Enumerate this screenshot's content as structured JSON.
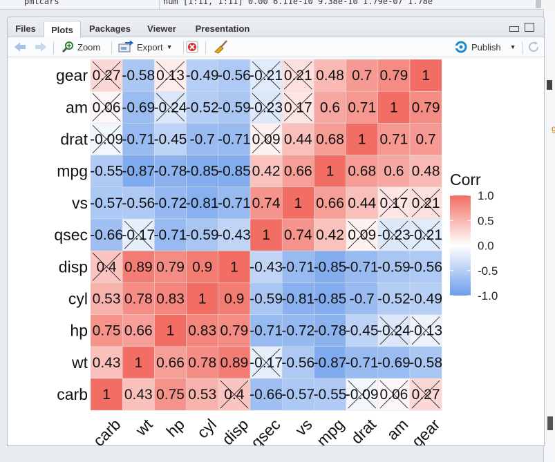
{
  "console_strip": {
    "name": "pmtcars",
    "value": "num [1:11, 1:11] 0.00 6.11e-10 9.38e-10 1.79e-07 1.78e"
  },
  "tabs": [
    {
      "label": "Files",
      "active": false
    },
    {
      "label": "Plots",
      "active": true
    },
    {
      "label": "Packages",
      "active": false
    },
    {
      "label": "Viewer",
      "active": false
    },
    {
      "label": "Presentation",
      "active": false
    }
  ],
  "toolbar": {
    "zoom": "Zoom",
    "export": "Export",
    "publish": "Publish"
  },
  "chart_data": {
    "type": "heatmap",
    "title": "",
    "x_categories": [
      "carb",
      "wt",
      "hp",
      "cyl",
      "disp",
      "qsec",
      "vs",
      "mpg",
      "drat",
      "am",
      "gear"
    ],
    "y_categories_top_to_bottom": [
      "gear",
      "am",
      "drat",
      "mpg",
      "vs",
      "qsec",
      "disp",
      "cyl",
      "hp",
      "wt",
      "carb"
    ],
    "values": [
      [
        "0.27",
        "-0.58",
        "0.13",
        "-0.49",
        "-0.56",
        "-0.21",
        "0.21",
        "0.48",
        "0.7",
        "0.79",
        "1"
      ],
      [
        "0.06",
        "-0.69",
        "-0.24",
        "-0.52",
        "-0.59",
        "-0.23",
        "0.17",
        "0.6",
        "0.71",
        "1",
        "0.79"
      ],
      [
        "-0.09",
        "-0.71",
        "-0.45",
        "-0.7",
        "-0.71",
        "0.09",
        "0.44",
        "0.68",
        "1",
        "0.71",
        "0.7"
      ],
      [
        "-0.55",
        "-0.87",
        "-0.78",
        "-0.85",
        "-0.85",
        "0.42",
        "0.66",
        "1",
        "0.68",
        "0.6",
        "0.48"
      ],
      [
        "-0.57",
        "-0.56",
        "-0.72",
        "-0.81",
        "-0.71",
        "0.74",
        "1",
        "0.66",
        "0.44",
        "0.17",
        "0.21"
      ],
      [
        "-0.66",
        "-0.17",
        "-0.71",
        "-0.59",
        "-0.43",
        "1",
        "0.74",
        "0.42",
        "0.09",
        "-0.23",
        "-0.21"
      ],
      [
        "0.4",
        "0.89",
        "0.79",
        "0.9",
        "1",
        "-0.43",
        "-0.71",
        "-0.85",
        "-0.71",
        "-0.59",
        "-0.56"
      ],
      [
        "0.53",
        "0.78",
        "0.83",
        "1",
        "0.9",
        "-0.59",
        "-0.81",
        "-0.85",
        "-0.7",
        "-0.52",
        "-0.49"
      ],
      [
        "0.75",
        "0.66",
        "1",
        "0.83",
        "0.79",
        "-0.71",
        "-0.72",
        "-0.78",
        "-0.45",
        "-0.24",
        "-0.13"
      ],
      [
        "0.43",
        "1",
        "0.66",
        "0.78",
        "0.89",
        "-0.17",
        "-0.56",
        "-0.87",
        "-0.71",
        "-0.69",
        "-0.58"
      ],
      [
        "1",
        "0.43",
        "0.75",
        "0.53",
        "0.4",
        "-0.66",
        "-0.57",
        "-0.55",
        "-0.09",
        "0.06",
        "0.27"
      ]
    ],
    "crossed_out": [
      [
        true,
        false,
        true,
        false,
        false,
        true,
        true,
        false,
        false,
        false,
        false
      ],
      [
        true,
        false,
        true,
        false,
        false,
        true,
        true,
        false,
        false,
        false,
        false
      ],
      [
        true,
        false,
        false,
        false,
        false,
        true,
        false,
        false,
        false,
        false,
        false
      ],
      [
        false,
        false,
        false,
        false,
        false,
        false,
        false,
        false,
        false,
        false,
        false
      ],
      [
        false,
        false,
        false,
        false,
        false,
        false,
        false,
        false,
        false,
        true,
        true
      ],
      [
        false,
        true,
        false,
        false,
        false,
        false,
        false,
        false,
        true,
        true,
        true
      ],
      [
        true,
        false,
        false,
        false,
        false,
        false,
        false,
        false,
        false,
        false,
        false
      ],
      [
        false,
        false,
        false,
        false,
        false,
        false,
        false,
        false,
        false,
        false,
        false
      ],
      [
        false,
        false,
        false,
        false,
        false,
        false,
        false,
        false,
        false,
        true,
        true
      ],
      [
        false,
        false,
        false,
        false,
        false,
        true,
        false,
        false,
        false,
        false,
        false
      ],
      [
        false,
        false,
        false,
        false,
        true,
        false,
        false,
        false,
        true,
        true,
        true
      ]
    ],
    "legend": {
      "title": "Corr",
      "ticks": [
        "1.0",
        "0.5",
        "0.0",
        "-0.5",
        "-1.0"
      ],
      "range": [
        -1,
        1
      ]
    },
    "colors": {
      "low": "#6d9eeb",
      "mid": "#ffffff",
      "high": "#f26d63"
    }
  }
}
